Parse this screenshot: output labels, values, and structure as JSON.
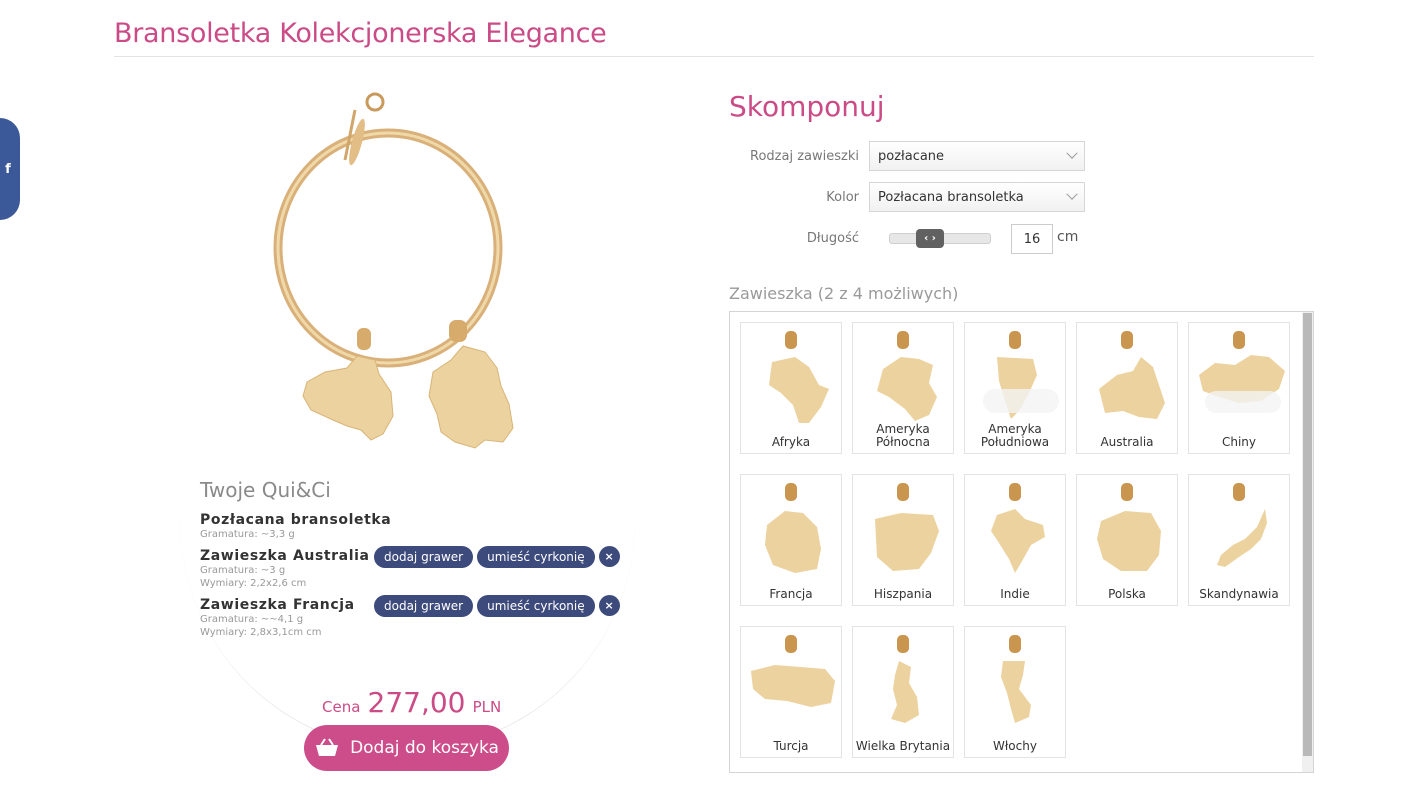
{
  "page": {
    "title": "Bransoletka Kolekcjonerska Elegance",
    "facebook_icon": "f"
  },
  "summary": {
    "title": "Twoje Qui&Ci",
    "bracelet": {
      "name": "Pozłacana bransoletka",
      "meta1": "Gramatura: ~3,3 g"
    },
    "items": [
      {
        "name": "Zawieszka Australia",
        "meta1": "Gramatura: ~3 g",
        "meta2": "Wymiary: 2,2x2,6 cm",
        "engrave": "dodaj grawer",
        "zircon": "umieść cyrkonię",
        "remove": "×"
      },
      {
        "name": "Zawieszka Francja",
        "meta1": "Gramatura: ~~4,1 g",
        "meta2": "Wymiary: 2,8x3,1cm cm",
        "engrave": "dodaj grawer",
        "zircon": "umieść cyrkonię",
        "remove": "×"
      }
    ],
    "price_label": "Cena",
    "price_value": "277,00",
    "price_currency": "PLN",
    "cart_button": "Dodaj do koszyka"
  },
  "config": {
    "title": "Skomponuj",
    "type_label": "Rodzaj zawieszki",
    "type_value": "pozłacane",
    "color_label": "Kolor",
    "color_value": "Pozłacana bransoletka",
    "length_label": "Długość",
    "length_value": "16",
    "length_unit": "cm",
    "charms_header": "Zawieszka (2 z 4 możliwych)",
    "charms": [
      {
        "label": "Afryka"
      },
      {
        "label": "Ameryka Północna"
      },
      {
        "label": "Ameryka Południowa"
      },
      {
        "label": "Australia"
      },
      {
        "label": "Chiny"
      },
      {
        "label": "Francja"
      },
      {
        "label": "Hiszpania"
      },
      {
        "label": "Indie"
      },
      {
        "label": "Polska"
      },
      {
        "label": "Skandynawia"
      },
      {
        "label": "Turcja"
      },
      {
        "label": "Wielka Brytania"
      },
      {
        "label": "Włochy"
      }
    ]
  },
  "colors": {
    "accent": "#cb4b86",
    "pill": "#3d4a7c",
    "gold": "#e8c98a",
    "facebook": "#3b5998"
  }
}
